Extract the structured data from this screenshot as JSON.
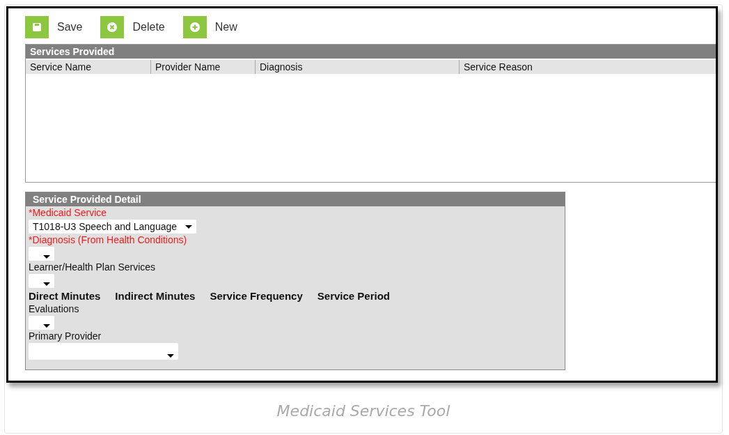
{
  "toolbar": [
    {
      "kind": "save",
      "label": "Save"
    },
    {
      "kind": "delete",
      "label": "Delete"
    },
    {
      "kind": "new",
      "label": "New"
    }
  ],
  "services_provided": {
    "title": "Services Provided",
    "columns": [
      "Service Name",
      "Provider Name",
      "Diagnosis",
      "Service Reason"
    ]
  },
  "detail": {
    "title": "Service Provided Detail",
    "items": [
      {
        "kind": "label",
        "text": "*Medicaid Service",
        "required": true
      },
      {
        "kind": "select",
        "value": "T1018-U3 Speech and Language"
      },
      {
        "kind": "label",
        "text": "*Diagnosis (From Health Conditions)",
        "required": true
      },
      {
        "kind": "select"
      },
      {
        "kind": "label",
        "text": "Learner/Health Plan Services",
        "required": false
      },
      {
        "kind": "select"
      },
      {
        "kind": "headings",
        "texts": [
          "Direct Minutes",
          "Indirect Minutes",
          "Service Frequency",
          "Service Period"
        ]
      },
      {
        "kind": "label",
        "text": "Evaluations",
        "required": false
      },
      {
        "kind": "select"
      },
      {
        "kind": "label",
        "text": "Primary Provider",
        "required": false
      },
      {
        "kind": "wide-select"
      }
    ]
  },
  "caption": "Medicaid Services Tool"
}
